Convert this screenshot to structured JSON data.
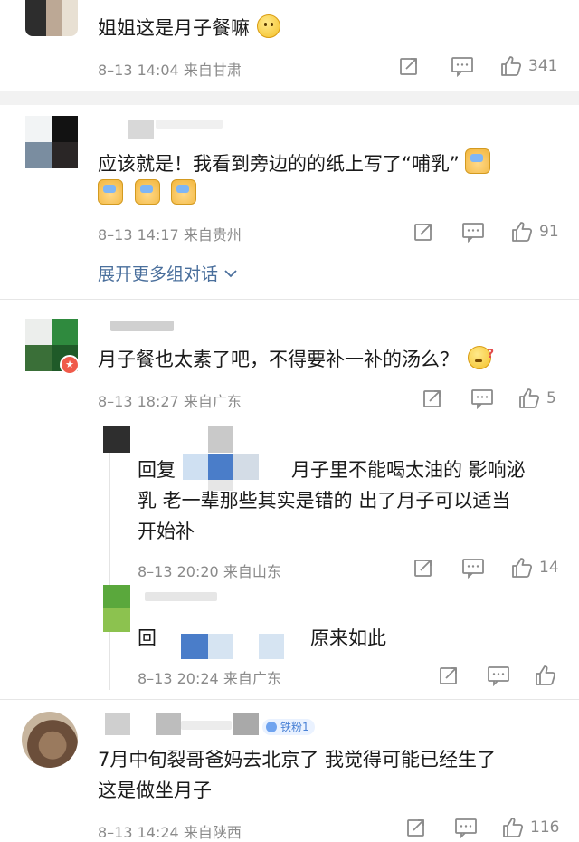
{
  "comments": [
    {
      "text": "姐姐这是月子餐嘛",
      "meta": "8–13 14:04  来自甘肃",
      "likes": "341",
      "emoji": "thinking-face"
    },
    {
      "text_line1": "应该就是！我看到旁边的的纸上写了“哺乳”",
      "meta": "8–13 14:17  来自贵州",
      "likes": "91",
      "emoji": "raised-hand"
    },
    {
      "text": "月子餐也太素了吧，不得要补一补的汤么？",
      "meta": "8–13 18:27  来自广东",
      "likes": "5",
      "emoji": "confused-face"
    },
    {
      "text": "7月中旬裂哥爸妈去北京了 我觉得可能已经生了",
      "text_line2": "这是做坐月子",
      "meta": "8–13 14:24  来自陕西",
      "likes": "116",
      "badge": "铁粉1"
    }
  ],
  "expand_label": "展开更多组对话",
  "replies": [
    {
      "prefix": "回复",
      "text_tail": "月子里不能喝太油的 影响泌",
      "text_line2": "乳 老一辈那些其实是错的 出了月子可以适当",
      "text_line3": "开始补",
      "meta": "8–13 20:20  来自山东",
      "likes": "14"
    },
    {
      "prefix": "回",
      "text_tail": "原来如此",
      "meta": "8–13 20:24  来自广东",
      "likes": ""
    }
  ],
  "colors": {
    "meta_gray": "#8a8a8a",
    "link_blue": "#4a6f9c",
    "badge_blue": "#4a82d6"
  }
}
